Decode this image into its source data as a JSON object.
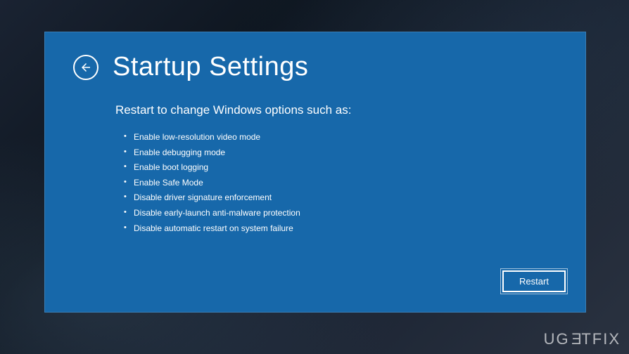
{
  "window": {
    "title": "Startup Settings",
    "subtitle": "Restart to change Windows options such as:",
    "options": [
      "Enable low-resolution video mode",
      "Enable debugging mode",
      "Enable boot logging",
      "Enable Safe Mode",
      "Disable driver signature enforcement",
      "Disable early-launch anti-malware protection",
      "Disable automatic restart on system failure"
    ],
    "restart_label": "Restart"
  },
  "watermark": "UGETFIX"
}
